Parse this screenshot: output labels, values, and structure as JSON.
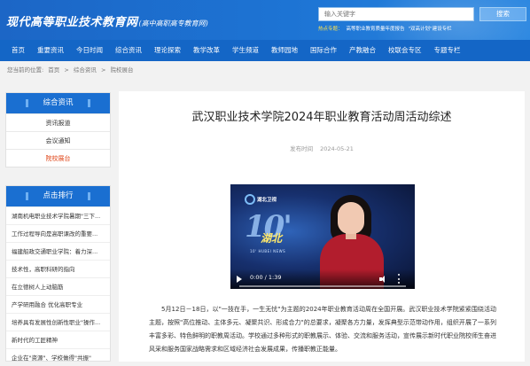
{
  "header": {
    "logo_main": "现代高等职业技术教育网",
    "logo_sub": "(高中高职高专教育网)",
    "search_placeholder": "输入关键字",
    "search_button": "搜索",
    "hot_label": "热点专题：",
    "hot_links": [
      "高等职业教育质量年度报告",
      "\"双高计划\"建设专栏"
    ]
  },
  "nav": {
    "items": [
      "首页",
      "重要资讯",
      "今日时闻",
      "综合资讯",
      "理论探索",
      "教学改革",
      "学生频道",
      "教师园地",
      "国际合作",
      "产教融合",
      "校联会专区",
      "专题专栏"
    ]
  },
  "breadcrumb": [
    "您当前的位置:",
    "首页",
    ">",
    "综合资讯",
    ">",
    "院校展台"
  ],
  "sidebar": {
    "news_title": "综合资讯",
    "news_items": [
      "资讯报道",
      "会议通知",
      "院校展台"
    ],
    "active_item": "院校展台",
    "rank_title": "点击排行",
    "rank_items": [
      "湖南机电职业技术学院暑期\"三下...",
      "工作过程导向是高职课改的重要...",
      "福建船政交通职业学院：着力深...",
      "技术性，高职科研的指向",
      "在立德树人上动脑筋",
      "产学研用融合 优化高职专业",
      "培养具有发展性创新性职业\"操作...",
      "新时代的工匠精神",
      "企业在\"资源\"、学校做得\"共振\""
    ]
  },
  "article": {
    "title": "武汉职业技术学院2024年职业教育活动周活动综述",
    "meta_label": "发布时间",
    "meta_date": "2024-05-21",
    "video": {
      "logo_text": "湖北卫视",
      "big_text": "10'",
      "hubei_text": "湖北",
      "sub_text": "10' HUBEI NEWS",
      "time": "0:00 / 1:39"
    },
    "body": "5月12日－18日，以\"一技在手，一生无忧\"为主题的2024年职业教育活动周在全国开展。武汉职业技术学院紧紧围绕活动主题，按照\"高位推动、主体多元、凝聚共识、形成合力\"的总要求，凝聚各方力量，发挥典型示范带动作用，组织开展了一系列丰富多彩、特色鲜明的职教周活动。学校通过多种形式的职教展示、体验、交流和服务活动，宣传展示新时代职业院校师生奋进风采和服务国家战略需求和区域经济社会发展成果，传播职教正能量。"
  },
  "colors": {
    "header_blue": "#1d74d4",
    "nav_blue": "#1466c6",
    "active_orange": "#e0491d",
    "hot_yellow": "#ffe34d"
  }
}
